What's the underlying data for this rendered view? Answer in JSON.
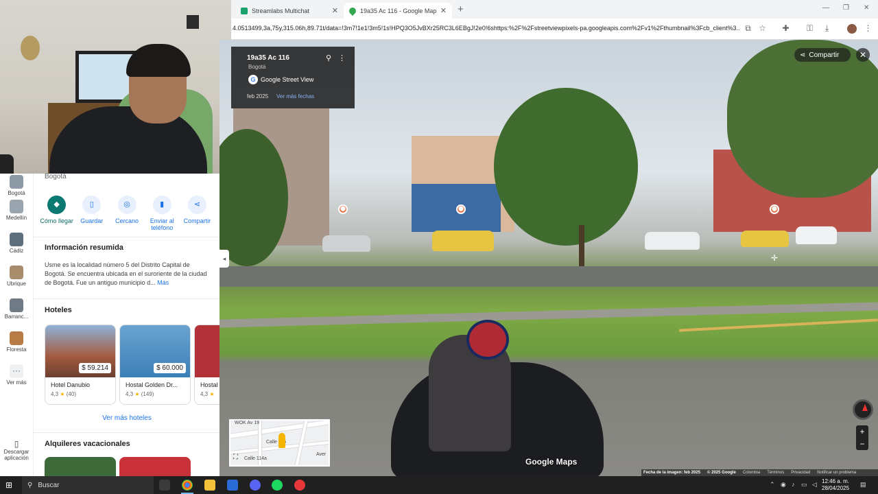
{
  "browser": {
    "tabs": [
      {
        "title": "Streamlabs Multichat",
        "close": "✕"
      },
      {
        "title": "19a35 Ac 116 - Google Maps",
        "close": "✕"
      }
    ],
    "new_tab": "+",
    "url": "4.0513499,3a,75y,315.06h,89.71t/data=!3m7!1e1!3m5!1s!HPQ3O5JvBXr25RC3L6EBgJ!2e0!6shttps:%2F%2Fstreetviewpixels-pa.googleapis.com%2Fv1%2Fthumbnail%3Fcb_client%3..."
  },
  "streetview": {
    "title": "19a35 Ac 116",
    "subtitle": "Bogotá",
    "source": "Google Street View",
    "date": "feb 2025",
    "more_dates": "Ver más fechas",
    "share": "Compartir",
    "logo": "Google Maps",
    "attribution": [
      "Fecha de la imagen: feb 2025",
      "© 2025 Google",
      "Colombia",
      "Términos",
      "Privacidad",
      "Notificar un problema"
    ],
    "minimap": {
      "label1": "WOK Av 19",
      "label2": "Calle 116",
      "label3": "Calle 114a",
      "label4": "Aver"
    }
  },
  "rail": {
    "items": [
      "Bogotá",
      "Medellín",
      "Cádiz",
      "Ubrique",
      "Barranc...",
      "Floresta",
      "Ver más"
    ],
    "download": "Descargar aplicación"
  },
  "panel": {
    "location": "Bogotá",
    "actions": [
      "Cómo llegar",
      "Guardar",
      "Cercano",
      "Enviar al teléfono",
      "Compartir"
    ],
    "summary_heading": "Información resumida",
    "summary_text": "Usme es la localidad número 5 del Distrito Capital de Bogotá. Se encuentra ubicada en el suroriente de la ciudad de Bogotá. Fue un antiguo municipio d...",
    "summary_more": "Más",
    "hotels_heading": "Hoteles",
    "hotels": [
      {
        "name": "Hotel Danubio",
        "price": "$ 59.214",
        "rating": "4,3",
        "reviews": "(40)"
      },
      {
        "name": "Hostal Golden Dr...",
        "price": "$ 60.000",
        "rating": "4,3",
        "reviews": "(149)"
      },
      {
        "name": "Hostal",
        "price": "",
        "rating": "4,3",
        "reviews": ""
      }
    ],
    "more_hotels": "Ver más hoteles",
    "rentals_heading": "Alquileres vacacionales"
  },
  "taskbar": {
    "search": "Buscar",
    "time": "12:46 a. m.",
    "date": "28/04/2025"
  }
}
